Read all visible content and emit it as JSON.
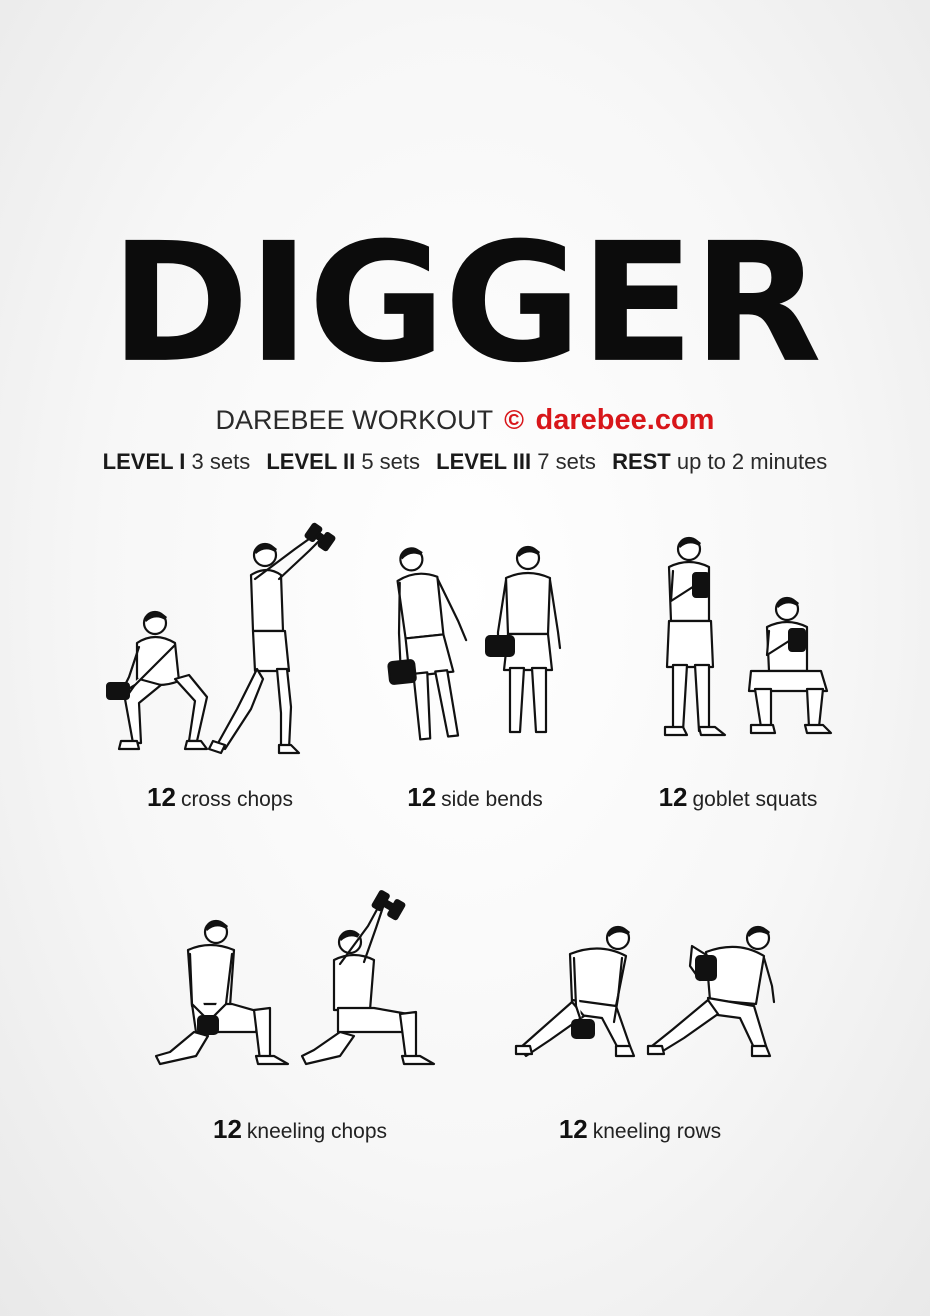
{
  "title": "DIGGER",
  "subtitle": {
    "prefix": "DAREBEE WORKOUT",
    "copyright_symbol": "©",
    "site": "darebee.com"
  },
  "levels": [
    {
      "label": "LEVEL I",
      "value": "3 sets"
    },
    {
      "label": "LEVEL II",
      "value": "5 sets"
    },
    {
      "label": "LEVEL III",
      "value": "7 sets"
    },
    {
      "label": "REST",
      "value": "up to 2 minutes"
    }
  ],
  "exercises": [
    {
      "reps": "12",
      "name": "cross chops",
      "icon": "cross-chops-illustration"
    },
    {
      "reps": "12",
      "name": "side bends",
      "icon": "side-bends-illustration"
    },
    {
      "reps": "12",
      "name": "goblet squats",
      "icon": "goblet-squats-illustration"
    },
    {
      "reps": "12",
      "name": "kneeling chops",
      "icon": "kneeling-chops-illustration"
    },
    {
      "reps": "12",
      "name": "kneeling rows",
      "icon": "kneeling-rows-illustration"
    }
  ],
  "colors": {
    "accent": "#d8161a",
    "text": "#1a1a1a",
    "background": "#f4f4f4"
  }
}
